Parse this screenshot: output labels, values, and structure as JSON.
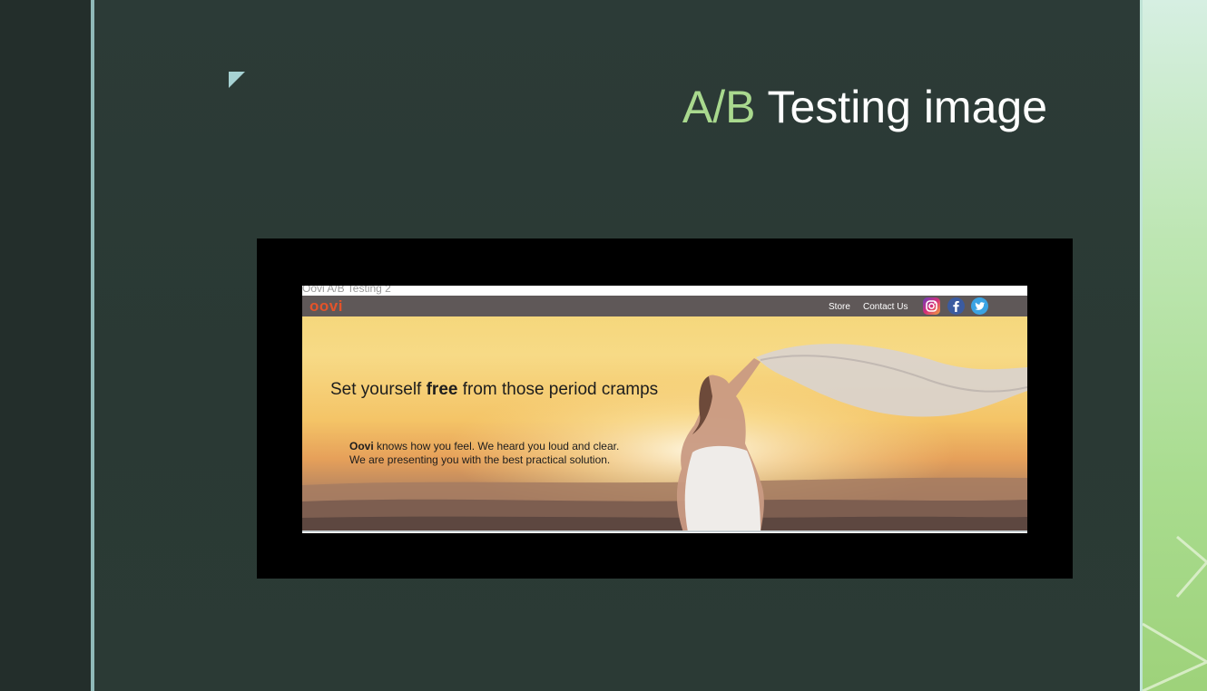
{
  "slide": {
    "title_accent": "A/B",
    "title_rest": " Testing image"
  },
  "screenshot": {
    "caption": "Oovi A/B Testing 2",
    "site": {
      "logo": "oovi",
      "nav": {
        "store": "Store",
        "contact": "Contact Us"
      },
      "social_icons": [
        "instagram-icon",
        "facebook-icon",
        "twitter-icon"
      ]
    },
    "hero": {
      "headline_pre": "Set yourself ",
      "headline_bold": "free",
      "headline_post": " from those period cramps",
      "sub_brand": "Oovi",
      "sub_line1_rest": " knows how you feel. We heard you loud and clear.",
      "sub_line2": "We are presenting you with the best practical solution."
    }
  },
  "colors": {
    "slide_bg": "#2c3b37",
    "accent_green": "#a9d98e",
    "left_rule": "#8fb9b8",
    "logo_orange": "#e4532a",
    "nav_bar": "#5f5858"
  }
}
